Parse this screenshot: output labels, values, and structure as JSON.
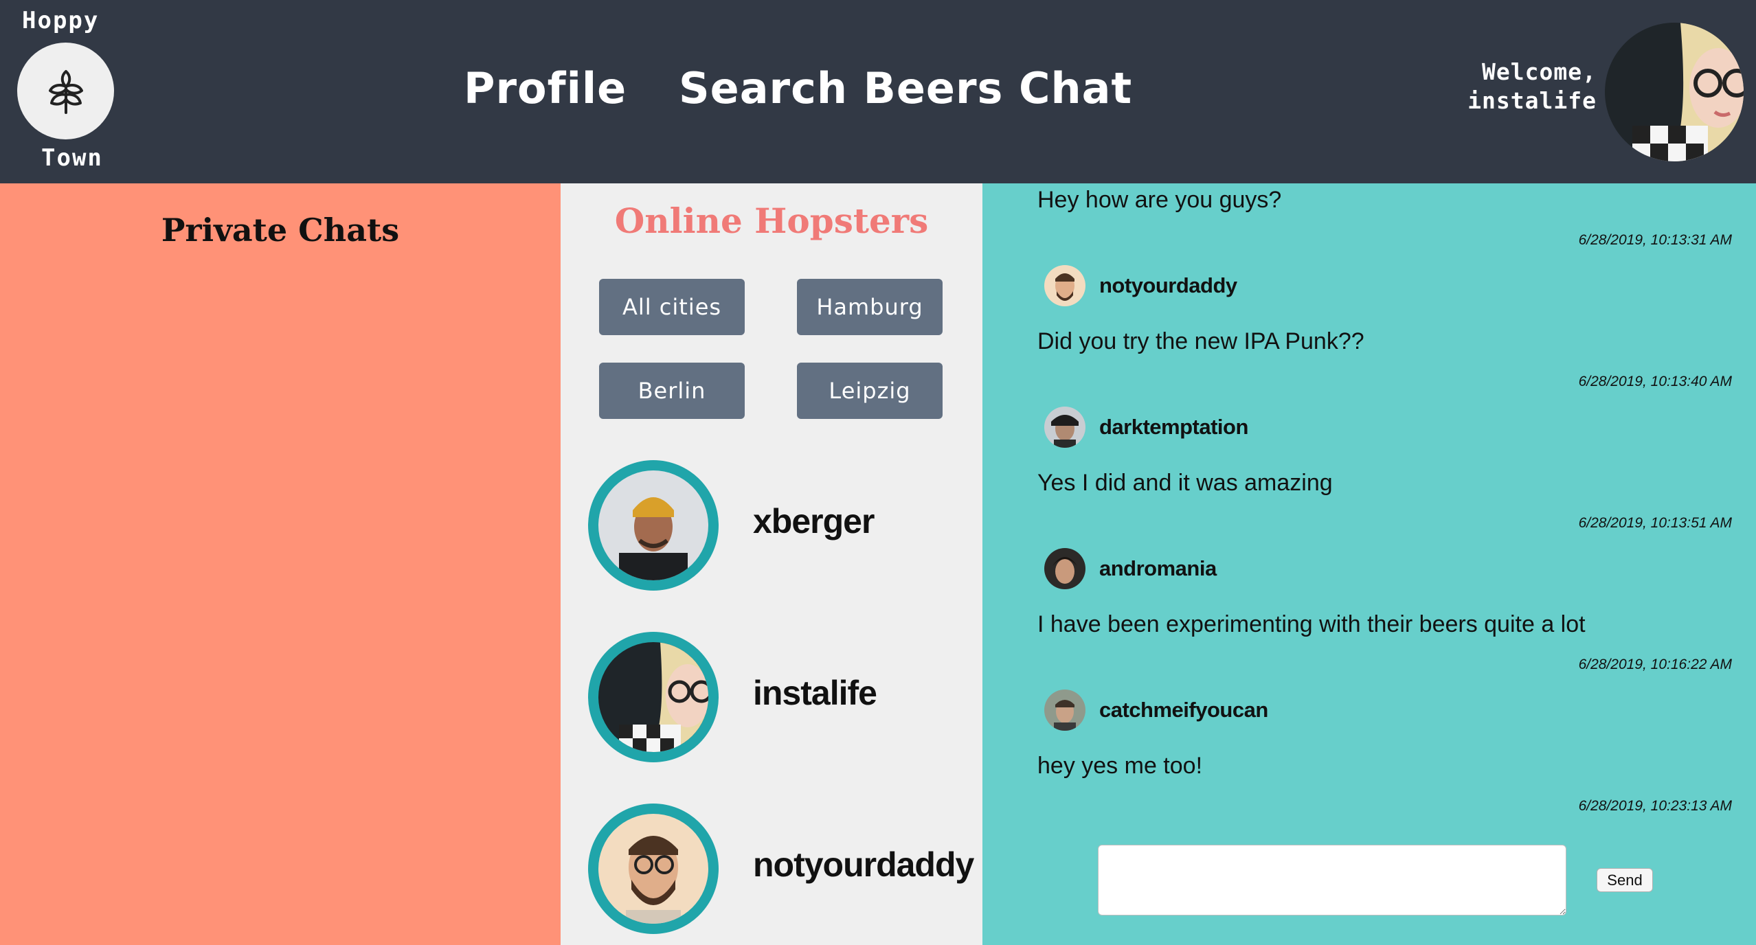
{
  "header": {
    "logo_top": "Hoppy",
    "logo_bottom": "Town",
    "nav": [
      {
        "label": "Profile"
      },
      {
        "label": "Search Beers"
      },
      {
        "label": "Chat"
      }
    ],
    "welcome_line1": "Welcome,",
    "welcome_line2": "instalife"
  },
  "private_chats": {
    "title": "Private Chats"
  },
  "online": {
    "title": "Online Hopsters",
    "cities": [
      "All cities",
      "Hamburg",
      "Berlin",
      "Leipzig"
    ],
    "users": [
      {
        "name": "xberger"
      },
      {
        "name": "instalife"
      },
      {
        "name": "notyourdaddy"
      }
    ]
  },
  "chat": {
    "messages": [
      {
        "author": "",
        "text": "Hey how are you guys?",
        "time": "6/28/2019, 10:13:31 AM"
      },
      {
        "author": "notyourdaddy",
        "text": "Did you try the new IPA Punk??",
        "time": "6/28/2019, 10:13:40 AM"
      },
      {
        "author": "darktemptation",
        "text": "Yes I did and it was amazing",
        "time": "6/28/2019, 10:13:51 AM"
      },
      {
        "author": "andromania",
        "text": "I have been experimenting with their beers quite a lot",
        "time": "6/28/2019, 10:16:22 AM"
      },
      {
        "author": "catchmeifyoucan",
        "text": "hey yes me too!",
        "time": "6/28/2019, 10:23:13 AM"
      }
    ],
    "input_value": "",
    "send_label": "Send"
  },
  "colors": {
    "header_bg": "#323945",
    "private_bg": "#ff9277",
    "online_bg": "#efefef",
    "chat_bg": "#67cfcb",
    "accent_ring": "#20a5aa",
    "online_title": "#f07a77",
    "city_button": "#627082"
  }
}
